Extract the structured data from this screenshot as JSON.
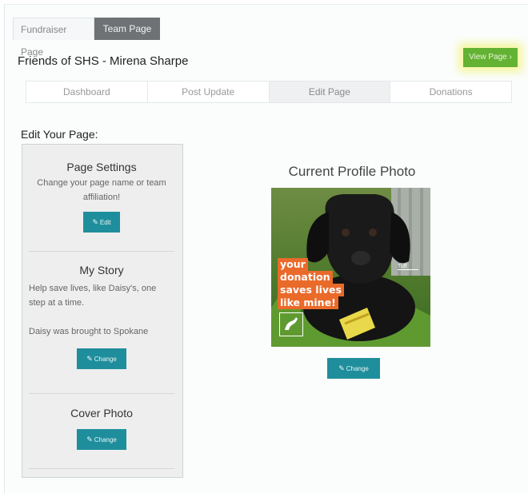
{
  "tabs": {
    "fundraiser": "Fundraiser Page",
    "team": "Team Page"
  },
  "page_title": "Friends of SHS - Mirena Sharpe",
  "view_button": "View Page",
  "subtabs": [
    "Dashboard",
    "Post Update",
    "Edit Page",
    "Donations"
  ],
  "edit_heading": "Edit Your Page:",
  "settings": {
    "title": "Page Settings",
    "desc": "Change your page name or team affiliation!",
    "button": "Edit"
  },
  "story": {
    "title": "My Story",
    "text": "Help save lives, like Daisy's, one step at a time.\n\nDaisy was brought to Spokane Humane Society as a",
    "button": "Change"
  },
  "cover": {
    "title": "Cover Photo",
    "button": "Change"
  },
  "profile": {
    "title": "Current Profile Photo",
    "promo": [
      "your",
      "donation",
      "saves lives",
      "like mine!"
    ],
    "tag": "Tuff",
    "button": "Change"
  },
  "colors": {
    "accent": "#1f8e9c",
    "green": "#63b234",
    "promo": "#ea6a2a"
  }
}
